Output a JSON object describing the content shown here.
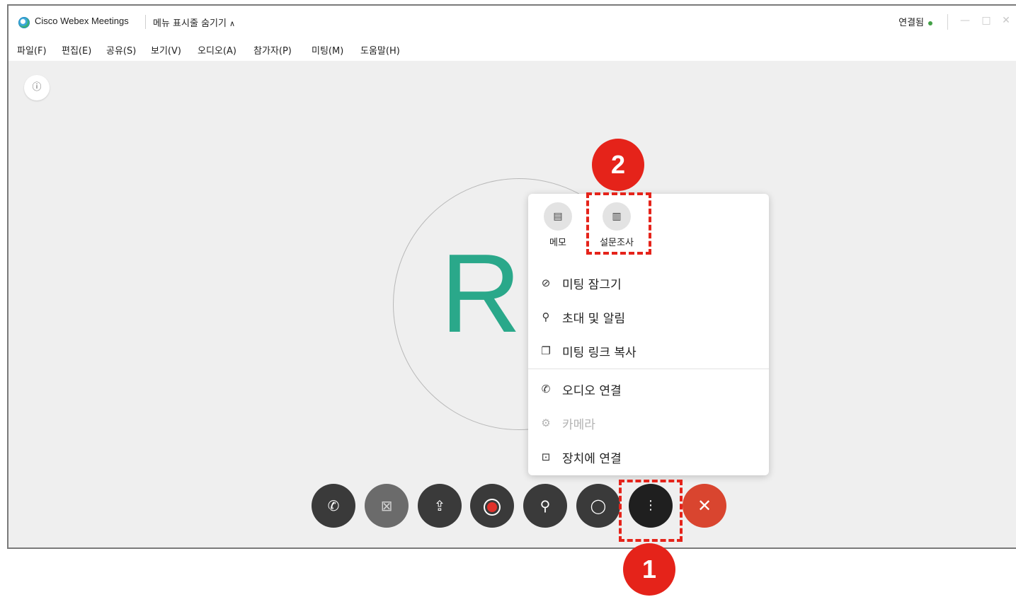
{
  "titlebar": {
    "app_title": "Cisco Webex Meetings",
    "menu_toggle_label": "메뉴 표시줄 숨기기",
    "menu_toggle_chevron": "∧",
    "connection_status": "연결됨",
    "status_color": "#43a047",
    "window_buttons": {
      "minimize": "—",
      "maximize": "□",
      "close": "✕"
    }
  },
  "menubar": {
    "items": [
      "파일(F)",
      "편집(E)",
      "공유(S)",
      "보기(V)",
      "오디오(A)",
      "참가자(P)",
      "미팅(M)",
      "도움말(H)"
    ]
  },
  "main": {
    "info_icon": "ⓘ",
    "avatar_initials": "RI",
    "avatar_color": "#2aa88a"
  },
  "more_menu": {
    "quick_actions": [
      {
        "icon": "notes-icon",
        "glyph": "▤",
        "label": "메모"
      },
      {
        "icon": "poll-icon",
        "glyph": "▥",
        "label": "설문조사"
      }
    ],
    "items": [
      {
        "icon": "lock-meeting-icon",
        "glyph": "⊘",
        "label": "미팅 잠그기"
      },
      {
        "icon": "invite-icon",
        "glyph": "⚲",
        "label": "초대 및 알림"
      },
      {
        "icon": "copy-icon",
        "glyph": "❐",
        "label": "미팅 링크 복사"
      },
      {
        "icon": "phone-icon",
        "glyph": "✆",
        "label": "오디오 연결"
      },
      {
        "icon": "gear-icon",
        "glyph": "⚙",
        "label": "카메라",
        "disabled": true
      },
      {
        "icon": "cast-icon",
        "glyph": "⊡",
        "label": "장치에 연결"
      }
    ]
  },
  "controls": {
    "audio": "✆",
    "video": "⊠",
    "share": "⇪",
    "participants": "⚲",
    "chat": "◯",
    "more": "⋮",
    "end": "✕"
  },
  "annotations": {
    "step1": "1",
    "step2": "2",
    "color": "#e5231a"
  }
}
